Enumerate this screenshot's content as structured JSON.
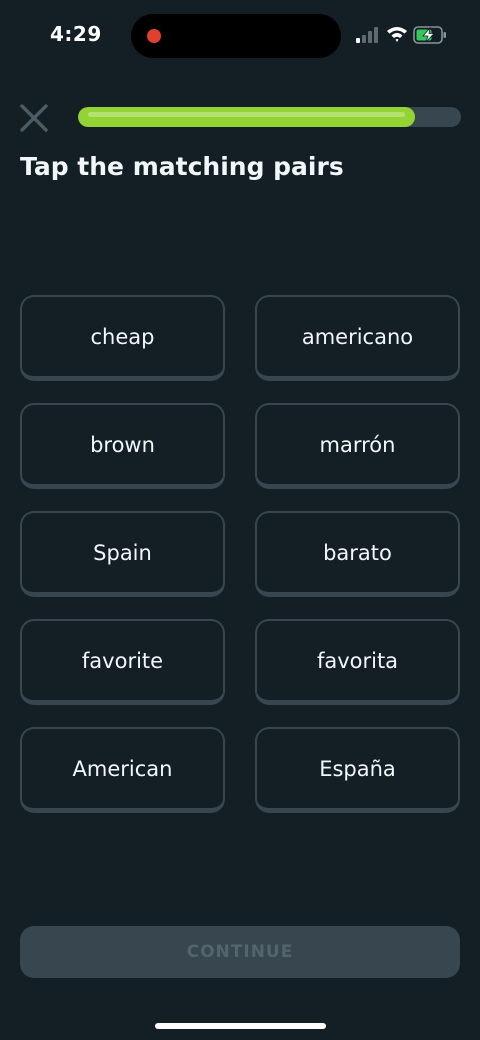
{
  "status_bar": {
    "time": "4:29"
  },
  "header": {
    "close_icon": "close-icon",
    "progress": 0.88
  },
  "instruction": "Tap the matching pairs",
  "pairs": {
    "rows": [
      {
        "left": "cheap",
        "right": "americano"
      },
      {
        "left": "brown",
        "right": "marrón"
      },
      {
        "left": "Spain",
        "right": "barato"
      },
      {
        "left": "favorite",
        "right": "favorita"
      },
      {
        "left": "American",
        "right": "España"
      }
    ]
  },
  "footer": {
    "continue_label": "CONTINUE"
  },
  "colors": {
    "background": "#131f24",
    "progress_fill": "#93d333",
    "tile_border": "#37464f",
    "continue_disabled_bg": "#37464f",
    "continue_disabled_text": "#52656d",
    "recording_dot": "#e2402f"
  }
}
